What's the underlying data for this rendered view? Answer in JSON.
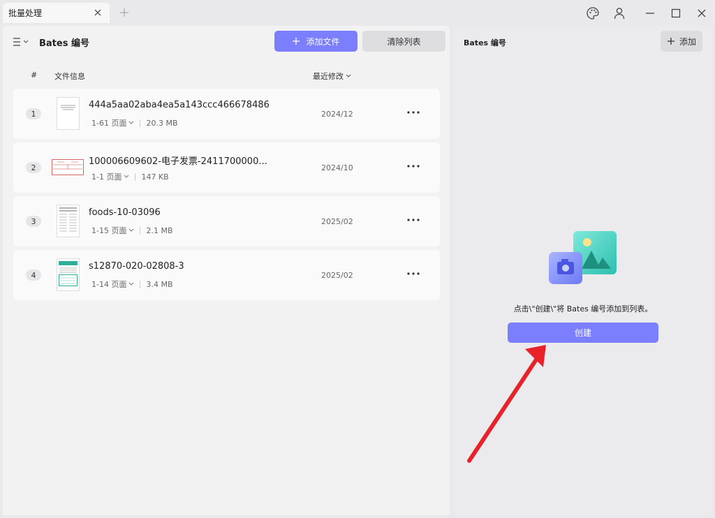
{
  "titlebar": {
    "tab_label": "批量处理",
    "icons": [
      "close-icon",
      "plus-icon",
      "palette-icon",
      "user-icon",
      "minimize-icon",
      "maximize-icon",
      "close-window-icon"
    ]
  },
  "left": {
    "title": "Bates 编号",
    "add_file_label": "添加文件",
    "clear_label": "清除列表",
    "columns": {
      "index": "#",
      "info": "文件信息",
      "modified": "最近修改"
    },
    "files": [
      {
        "index": "1",
        "name": "444a5aa02aba4ea5a143ccc466678486",
        "pages": "1-61 页面",
        "size": "20.3 MB",
        "date": "2024/12"
      },
      {
        "index": "2",
        "name": "100006609602-电子发票-2411700000...",
        "pages": "1-1 页面",
        "size": "147 KB",
        "date": "2024/10"
      },
      {
        "index": "3",
        "name": "foods-10-03096",
        "pages": "1-15 页面",
        "size": "2.1 MB",
        "date": "2025/02"
      },
      {
        "index": "4",
        "name": "s12870-020-02808-3",
        "pages": "1-14 页面",
        "size": "3.4 MB",
        "date": "2025/02"
      }
    ]
  },
  "right": {
    "title": "Bates 编号",
    "add_label": "添加",
    "empty_text": "点击\\\"创建\\\"将 Bates 编号添加到列表。",
    "create_label": "创建"
  },
  "colors": {
    "accent": "#7b7ffd",
    "arrow": "#e8222a"
  }
}
